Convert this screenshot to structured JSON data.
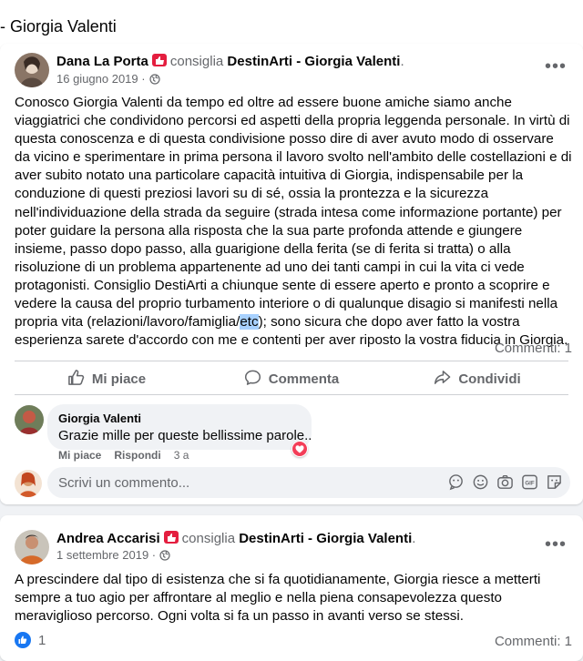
{
  "topbar": {
    "title": "- Giorgia Valenti"
  },
  "posts": [
    {
      "author": "Dana La Porta",
      "verb": "consiglia",
      "page": "DestinArti - Giorgia Valenti",
      "period": ".",
      "date": "16 giugno 2019 ·",
      "text_before_highlight": "Conosco Giorgia Valenti da tempo ed oltre ad essere buone amiche siamo anche viaggiatrici che condividono percorsi ed aspetti della propria leggenda personale. In virtù di questa conoscenza e di questa condivisione posso dire di aver avuto modo di osservare da vicino e sperimentare in prima persona il lavoro svolto nell'ambito delle costellazioni e di aver subito notato una particolare capacità intuitiva di Giorgia, indispensabile per la conduzione di questi preziosi lavori su di sé, ossia la prontezza e la sicurezza nell'individuazione della strada da seguire (strada intesa come informazione portante) per poter guidare la persona alla risposta che la sua parte profonda attende e giungere insieme, passo dopo passo, alla guarigione della ferita (se di ferita si tratta) o alla risoluzione di un problema appartenente ad uno dei tanti campi in cui la vita ci vede protagonisti. Consiglio DestiArti a chiunque sente di essere aperto e pronto a scoprire e vedere la causa del proprio turbamento interiore o di qualunque disagio si manifesti nella propria vita (relazioni/lavoro/famiglia/",
      "highlight": "etc",
      "text_after_highlight": "); sono sicura che dopo aver fatto la vostra esperienza sarete d'accordo con me e contenti per aver riposto la vostra fiducia in Giorgia.",
      "comments_count": "Commenti: 1",
      "actions": {
        "like": "Mi piace",
        "comment": "Commenta",
        "share": "Condividi"
      },
      "comment": {
        "author": "Giorgia Valenti",
        "text": "Grazie mille per queste bellissime parole..",
        "like": "Mi piace",
        "reply": "Rispondi",
        "age": "3 a"
      },
      "write_placeholder": "Scrivi un commento..."
    },
    {
      "author": "Andrea Accarisi",
      "verb": "consiglia",
      "page": "DestinArti - Giorgia Valenti",
      "period": ".",
      "date": "1 settembre 2019 ·",
      "text": "A prescindere dal tipo di esistenza  che si fa quotidianamente, Giorgia riesce a metterti sempre a tuo agio per affrontare al meglio e nella piena consapevolezza  questo meraviglioso percorso. Ogni volta si fa un passo in avanti verso se stessi.",
      "likes": "1",
      "comments_count": "Commenti: 1"
    }
  ],
  "colors": {
    "accent": "#1877f2",
    "badge": "#e41e3f",
    "secondary_text": "#65676b",
    "highlight": "#a8d1ff",
    "heart": "#f33e58"
  },
  "icons": [
    "recommend-badge-icon",
    "globe-icon",
    "more-options-icon",
    "thumbs-up-icon",
    "comment-icon",
    "share-icon",
    "heart-reaction-icon",
    "sticker-icon",
    "emoji-icon",
    "camera-icon",
    "gif-icon",
    "avatar-sticker-icon",
    "like-count-icon"
  ]
}
